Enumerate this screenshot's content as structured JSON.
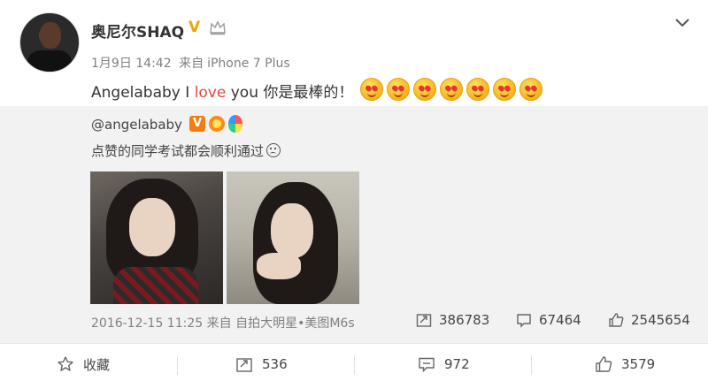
{
  "author": {
    "name": "奥尼尔SHAQ",
    "verified_badge": "V",
    "date": "1月9日 14:42",
    "source_prefix": "来自",
    "device": "iPhone 7 Plus"
  },
  "post": {
    "text_before": "Angelababy I ",
    "text_keyword": "love",
    "text_after": " you 你是最棒的！",
    "emoji_count": 7
  },
  "repost": {
    "author": "@angelababy",
    "verified_badge": "V",
    "text": "点赞的同学考试都会顺利通过",
    "date": "2016-12-15 11:25",
    "source_prefix": "来自",
    "source": "自拍大明星•美图M6s",
    "stats": {
      "reposts": "386783",
      "comments": "67464",
      "likes": "2545654"
    }
  },
  "actions": {
    "favorite_label": "收藏",
    "repost_count": "536",
    "comment_count": "972",
    "like_count": "3579"
  },
  "colors": {
    "keyword": "#e04a3a",
    "repost_bg": "#f2f2f2",
    "verified": "#f0a30a"
  },
  "icons": [
    "chevron-down-icon",
    "crown-icon",
    "star-icon",
    "repost-icon",
    "comment-icon",
    "thumbs-up-icon",
    "sad-face-icon",
    "heart-eyes-emoji-icon"
  ]
}
